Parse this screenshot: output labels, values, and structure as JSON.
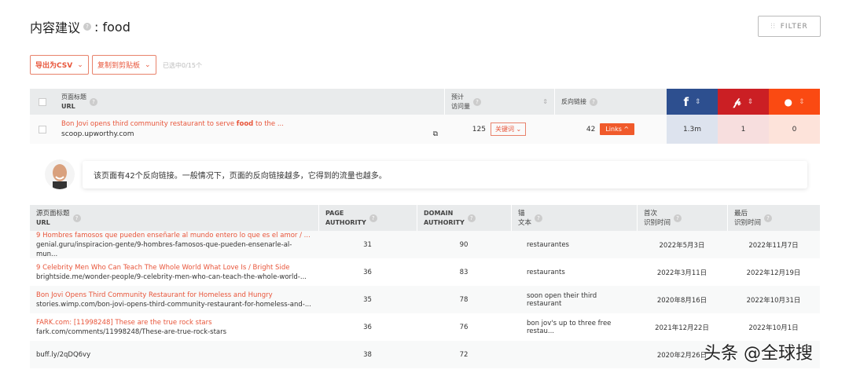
{
  "header": {
    "title": "内容建议",
    "keyword": ": food",
    "filter_label": "FILTER"
  },
  "toolbar": {
    "export_csv": "导出为CSV",
    "copy_clipboard": "复制到剪贴板",
    "selected_count": "已选中0/15个"
  },
  "main_table": {
    "headers": {
      "title_line1": "页面标题",
      "title_line2": "URL",
      "visits_line1": "预计",
      "visits_line2": "访问量",
      "backlinks": "反向链接"
    },
    "social_colors": {
      "facebook": "#2d4f8f",
      "pinterest": "#cb1f24",
      "reddit": "#fa4a12"
    },
    "row": {
      "title_pre": "Bon Jovi opens third community restaurant to serve ",
      "title_kw": "food",
      "title_post": " to the ...",
      "url": "scoop.upworthy.com",
      "visits": "125",
      "keywords_btn": "关键词",
      "backlinks": "42",
      "links_btn": "Links",
      "facebook": "1.3m",
      "pinterest": "1",
      "reddit": "0"
    }
  },
  "tip": {
    "text": "该页面有42个反向链接。一般情况下，页面的反向链接越多，它得到的流量也越多。"
  },
  "links_table": {
    "headers": {
      "source_line1": "源页面标题",
      "source_line2": "URL",
      "pa_line1": "PAGE",
      "pa_line2": "AUTHORITY",
      "da_line1": "DOMAIN",
      "da_line2": "AUTHORITY",
      "anchor_line1": "锚",
      "anchor_line2": "文本",
      "first_line1": "首次",
      "first_line2": "识别时间",
      "last_line1": "最后",
      "last_line2": "识别时间"
    },
    "rows": [
      {
        "title": "9 Hombres famosos que pueden enseñarle al mundo entero lo que es el amor / ...",
        "url": "genial.guru/inspiracion-gente/9-hombres-famosos-que-pueden-ensenarle-al-mun...",
        "pa": "31",
        "da": "90",
        "anchor": "restaurantes",
        "first": "2022年5月3日",
        "last": "2022年11月7日"
      },
      {
        "title": "9 Celebrity Men Who Can Teach The Whole World What Love Is / Bright Side",
        "url": "brightside.me/wonder-people/9-celebrity-men-who-can-teach-the-whole-world-...",
        "pa": "36",
        "da": "83",
        "anchor": "restaurants",
        "first": "2022年3月11日",
        "last": "2022年12月19日"
      },
      {
        "title": "Bon Jovi Opens Third Community Restaurant for Homeless and Hungry",
        "url": "stories.wimp.com/bon-jovi-opens-third-community-restaurant-for-homeless-and-...",
        "pa": "35",
        "da": "78",
        "anchor": "soon open their third restaurant",
        "first": "2020年8月16日",
        "last": "2022年10月31日"
      },
      {
        "title": "FARK.com: [11998248] These are the true rock stars",
        "url": "fark.com/comments/11998248/These-are-true-rock-stars",
        "pa": "36",
        "da": "76",
        "anchor": "bon jov's up to three free restau...",
        "first": "2021年12月22日",
        "last": "2022年10月1日"
      },
      {
        "title": "",
        "url": "buff.ly/2qDQ6vy",
        "pa": "38",
        "da": "72",
        "anchor": "",
        "first": "2020年2月26日",
        "last": ""
      }
    ]
  },
  "watermark": "头条 @全球搜"
}
